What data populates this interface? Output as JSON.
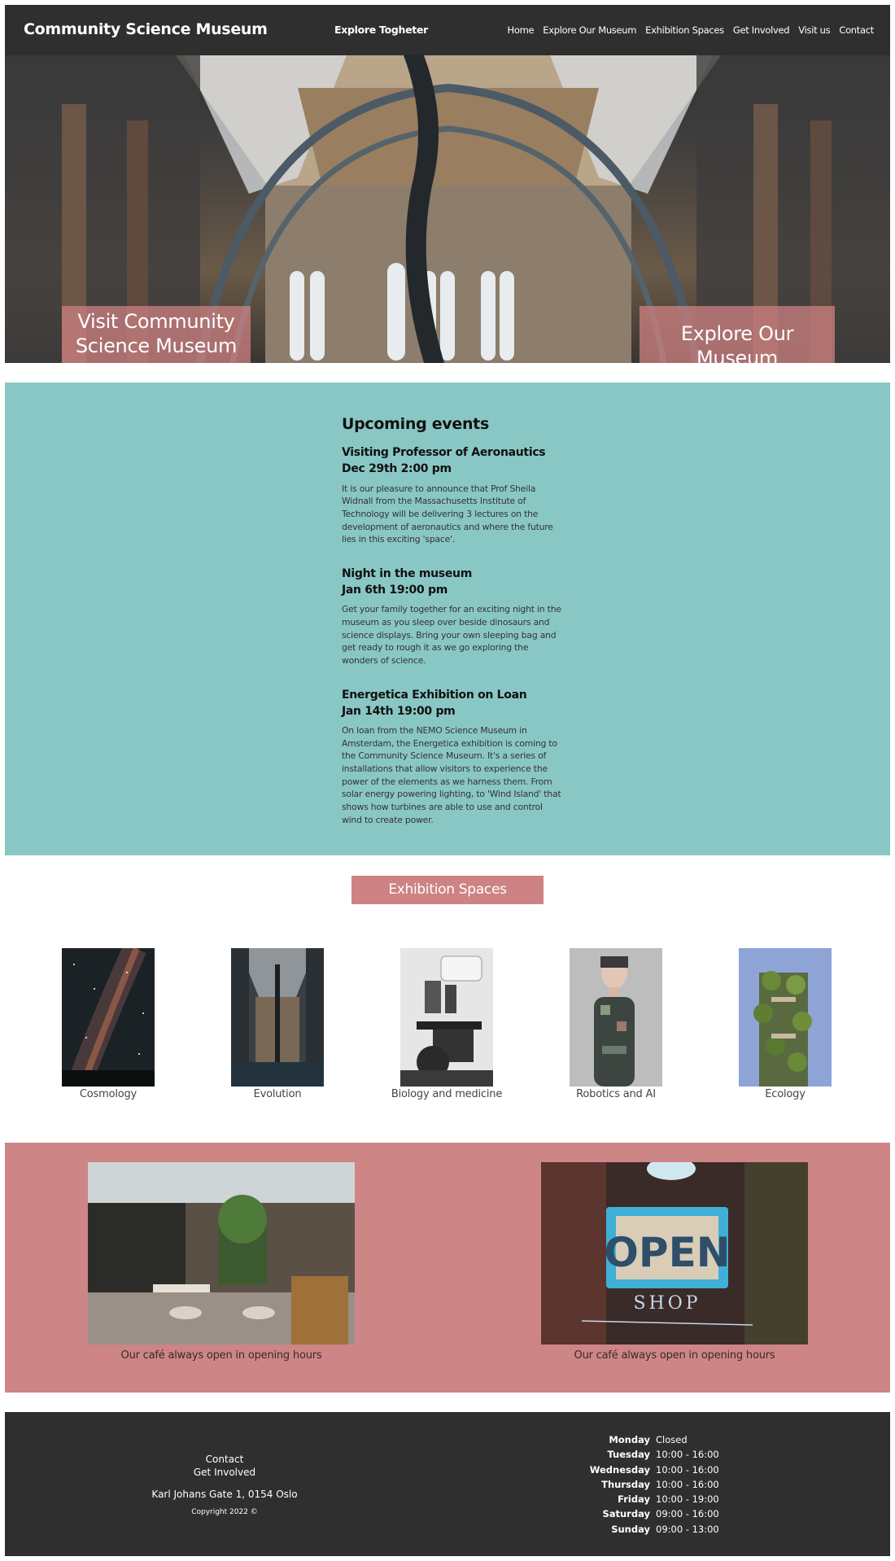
{
  "header": {
    "brand": "Community Science Museum",
    "tagline": "Explore Togheter",
    "nav": [
      "Home",
      "Explore Our Museum",
      "Exhibition Spaces",
      "Get Involved",
      "Visit us",
      "Contact"
    ]
  },
  "hero": {
    "caption_left": "Visit Community Science Museum",
    "caption_right": "Explore Our Museum"
  },
  "events": {
    "title": "Upcoming events",
    "items": [
      {
        "name": "Visiting Professor of Aeronautics",
        "date": "Dec 29th 2:00 pm",
        "text": "It is our pleasure to announce that Prof Sheila Widnall from the Massachusetts Institute of Technology will be delivering 3 lectures on the development of aeronautics and where the future lies in this exciting 'space'."
      },
      {
        "name": "Night in the museum",
        "date": "Jan 6th 19:00 pm",
        "text": "Get your family together for an exciting night in the museum as you sleep over beside dinosaurs and science displays. Bring your own sleeping bag and get ready to rough it as we go exploring the wonders of science."
      },
      {
        "name": "Energetica Exhibition on Loan",
        "date": "Jan 14th 19:00 pm",
        "text": "On loan from the NEMO Science Museum in Amsterdam, the Energetica exhibition is coming to the Community Science Museum. It's a series of installations that allow visitors to experience the power of the elements as we harness them. From solar energy powering lighting, to 'Wind Island' that shows how turbines are able to use and control wind to create power."
      }
    ]
  },
  "exhibitions": {
    "title": "Exhibition Spaces",
    "items": [
      "Cosmology",
      "Evolution",
      "Biology and medicine",
      "Robotics and AI",
      "Ecology"
    ]
  },
  "cafe": {
    "items": [
      {
        "caption": "Our café always open in opening hours"
      },
      {
        "caption": "Our café always open in opening hours",
        "sign_word": "OPEN",
        "sign_sub": "SHOP"
      }
    ]
  },
  "footer": {
    "contact": "Contact",
    "get_involved": "Get Involved",
    "address": "Karl Johans Gate 1, 0154 Oslo",
    "copyright": "Copyright 2022 ©",
    "hours": [
      {
        "day": "Monday",
        "time": "Closed"
      },
      {
        "day": "Tuesday",
        "time": "10:00 - 16:00"
      },
      {
        "day": "Wednesday",
        "time": "10:00 - 16:00"
      },
      {
        "day": "Thursday",
        "time": "10:00 - 16:00"
      },
      {
        "day": "Friday",
        "time": "10:00 - 19:00"
      },
      {
        "day": "Saturday",
        "time": "09:00 - 16:00"
      },
      {
        "day": "Sunday",
        "time": "09:00 - 13:00"
      }
    ]
  }
}
